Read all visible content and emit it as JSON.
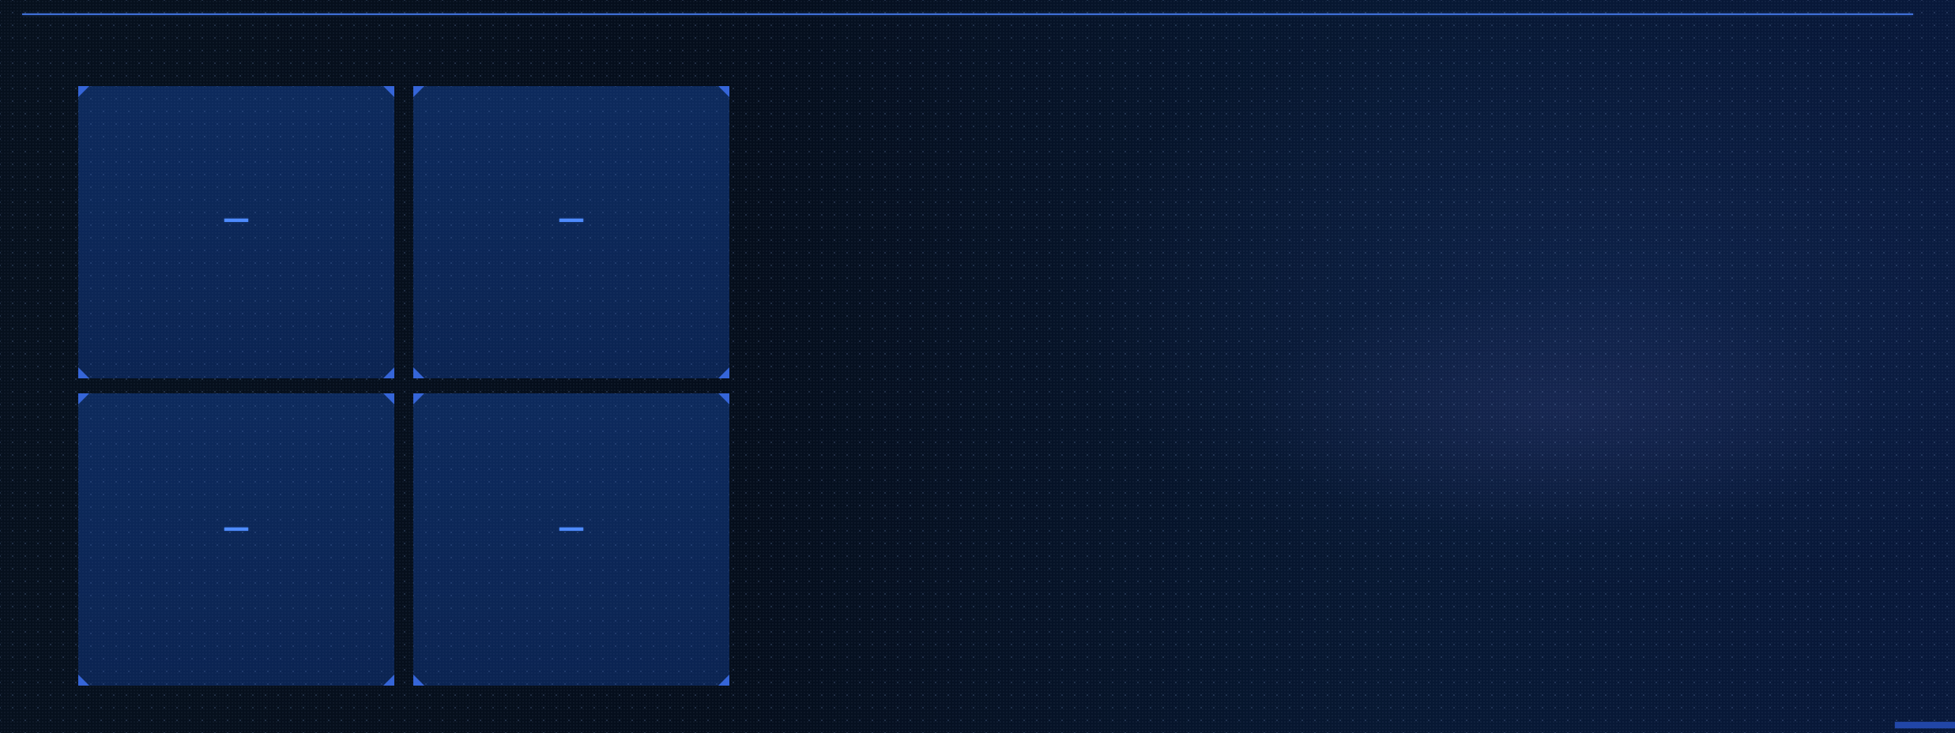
{
  "tiles": [
    {
      "value": "—"
    },
    {
      "value": "—"
    },
    {
      "value": "—"
    },
    {
      "value": "—"
    }
  ],
  "colors": {
    "background": "#050d1b",
    "tile_fill": "#0d2a5d",
    "accent": "#3f6fd6",
    "value_text": "#4e8bff",
    "corner_mark": "#2146a8"
  }
}
